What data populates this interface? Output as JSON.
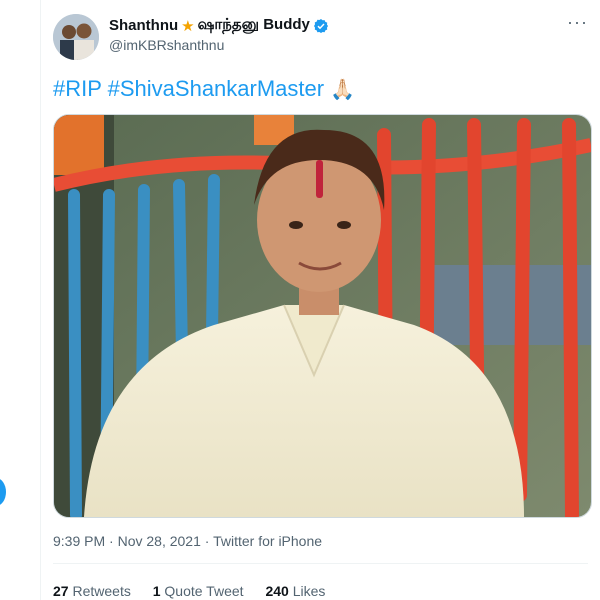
{
  "tweet": {
    "author_name": "Shanthnu",
    "author_name_suffix": "ஷாந்தனு Buddy",
    "author_handle": "@imKBRshanthnu",
    "star_icon": "star-icon",
    "verified_icon": "verified-badge-icon",
    "more_icon": "more-options-icon",
    "text": {
      "tag1": "#RIP",
      "tag2": "#ShivaShankarMaster",
      "emoji": "🙏🏻"
    },
    "media": {
      "alt_icon": "photo"
    },
    "time": "9:39 PM",
    "separator": "·",
    "date": "Nov 28, 2021",
    "source": "Twitter for iPhone"
  },
  "stats": {
    "retweets_count": "27",
    "retweets_label": "Retweets",
    "quotes_count": "1",
    "quotes_label": "Quote Tweet",
    "likes_count": "240",
    "likes_label": "Likes"
  },
  "colors": {
    "link": "#1d9bf0",
    "verified": "#1d9bf0",
    "star": "#f4a300",
    "muted": "#536471"
  }
}
